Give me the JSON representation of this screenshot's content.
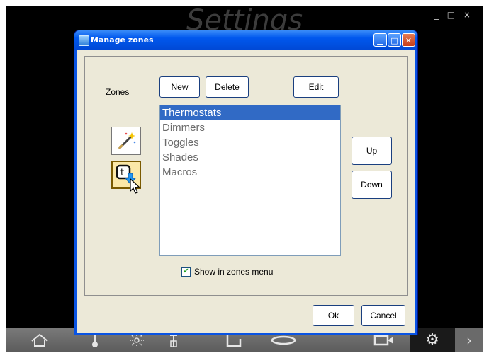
{
  "background": {
    "title": "Settings"
  },
  "dialog": {
    "title": "Manage zones",
    "zones_label": "Zones",
    "buttons": {
      "new": "New",
      "delete": "Delete",
      "edit": "Edit",
      "up": "Up",
      "down": "Down",
      "ok": "Ok",
      "cancel": "Cancel"
    },
    "zones": [
      "Thermostats",
      "Dimmers",
      "Toggles",
      "Shades",
      "Macros"
    ],
    "selected_zone": "Thermostats",
    "show_in_zones_menu": {
      "label": "Show in zones menu",
      "checked": true
    }
  },
  "taskbar": {
    "icons": [
      "home-icon",
      "thermometer-icon",
      "dimmer-icon",
      "toggle-icon",
      "shades-icon",
      "macro-icon",
      "camera-icon",
      "gear-icon",
      "next-icon"
    ]
  }
}
